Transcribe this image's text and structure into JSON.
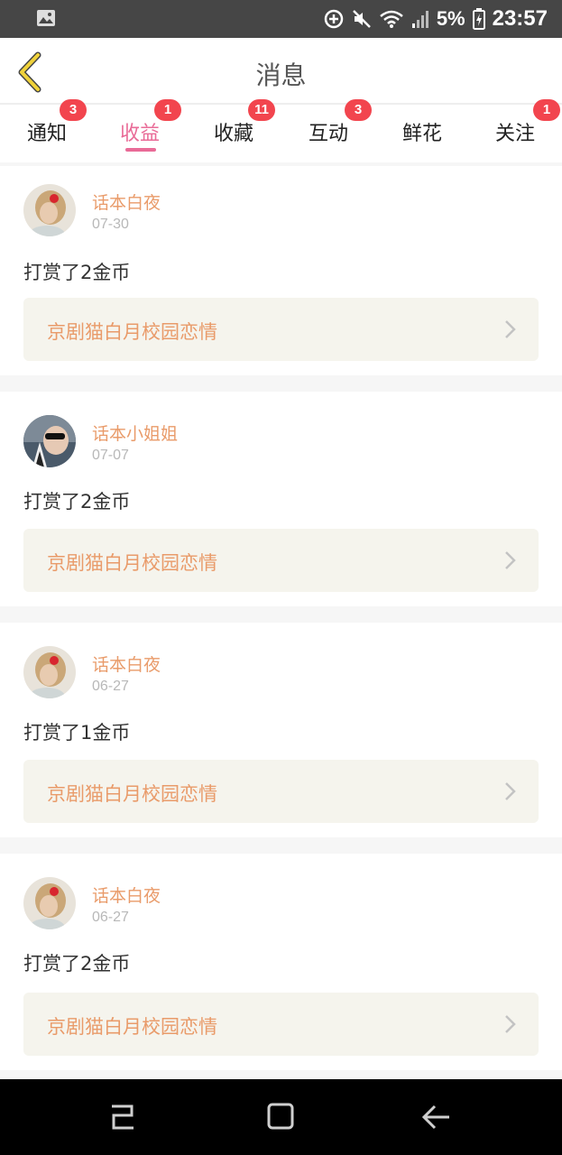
{
  "status_bar": {
    "battery_percent": "5%",
    "time": "23:57",
    "icons": [
      "gallery-icon",
      "data-saver-icon",
      "mute-icon",
      "wifi-icon",
      "signal-icon",
      "battery-icon"
    ]
  },
  "header": {
    "title": "消息",
    "back_icon": "chevron-left-icon"
  },
  "tabs": [
    {
      "label": "通知",
      "badge": "3"
    },
    {
      "label": "收益",
      "badge": "1",
      "active": true
    },
    {
      "label": "收藏",
      "badge": "11"
    },
    {
      "label": "互动",
      "badge": "3"
    },
    {
      "label": "鲜花",
      "badge": ""
    },
    {
      "label": "关注",
      "badge": "1"
    }
  ],
  "messages": [
    {
      "user": "话本白夜",
      "date": "07-30",
      "text": "打赏了2金币",
      "work": "京剧猫白月校园恋情",
      "avatar": "avatar-girl-flower"
    },
    {
      "user": "话本小姐姐",
      "date": "07-07",
      "text": "打赏了2金币",
      "work": "京剧猫白月校园恋情",
      "avatar": "avatar-girl-sunglasses"
    },
    {
      "user": "话本白夜",
      "date": "06-27",
      "text": "打赏了1金币",
      "work": "京剧猫白月校园恋情",
      "avatar": "avatar-girl-flower"
    },
    {
      "user": "话本白夜",
      "date": "06-27",
      "text": "打赏了2金币",
      "work": "京剧猫白月校园恋情",
      "avatar": "avatar-girl-flower"
    }
  ],
  "colors": {
    "accent": "#e96b97",
    "badge": "#f2454e",
    "name": "#e99b6a",
    "link_bg": "#f5f4ed",
    "back_arrow": "#f0d23a"
  },
  "nav_bar": {
    "icons": [
      "recent-apps-icon",
      "home-icon",
      "back-icon"
    ]
  }
}
